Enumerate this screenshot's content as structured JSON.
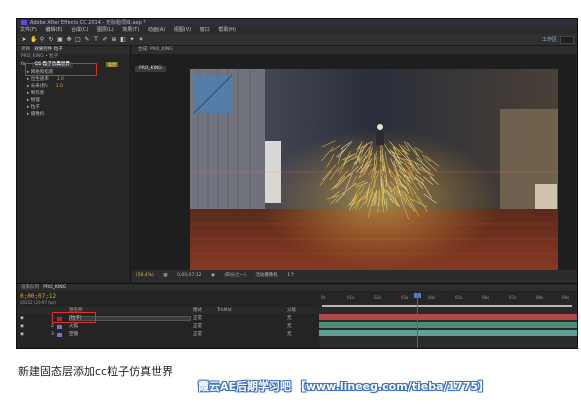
{
  "app": {
    "title": "Adobe After Effects CC 2014 - 无标题项目.aep *",
    "menu": [
      "文件(F)",
      "编辑(E)",
      "合成(C)",
      "图层(L)",
      "效果(T)",
      "动画(A)",
      "视图(V)",
      "窗口",
      "帮助(H)"
    ],
    "workspace": "工作区"
  },
  "effect_controls": {
    "tab_project": "项目",
    "tab_effect": "效果控件 粒子",
    "layer_path": "PRO_KING • 粒子",
    "effect_name": "CC 粒子仿真世界",
    "reset_label": "重置",
    "properties": [
      {
        "label": "网格和指南",
        "value": ""
      },
      {
        "label": "出生速率",
        "value": "1.0"
      },
      {
        "label": "长寿(秒)",
        "value": "1.0"
      },
      {
        "label": "制作者",
        "value": ""
      },
      {
        "label": "物理",
        "value": ""
      },
      {
        "label": "粒子",
        "value": ""
      },
      {
        "label": "摄像机",
        "value": ""
      }
    ]
  },
  "viewer": {
    "tab_label": "合成: PRO_KING",
    "comp_tab": "PRO_KING",
    "zoom": "(56.4%)",
    "timecode": "0;00;07;12",
    "resolution": "(四分之一)",
    "camera": "活动摄像机",
    "views": "1个"
  },
  "timeline": {
    "tab_render": "渲染队列",
    "tab_comp": "PRO_KING",
    "timecode": "0;00;07;12",
    "fps": "00222 (29.97 fps)",
    "col_source": "源名称",
    "col_mode": "模式",
    "col_trkmat": "TrkMat",
    "col_parent": "父级",
    "ruler": [
      "0s",
      "01s",
      "02s",
      "03s",
      "04s",
      "05s",
      "06s",
      "07s",
      "08s",
      "09s"
    ],
    "layers": [
      {
        "num": "1",
        "name": "[粒子]",
        "mode": "正常",
        "parent": "无",
        "color": "#b02a2a"
      },
      {
        "num": "2",
        "name": "火焰",
        "mode": "正常",
        "parent": "无",
        "color": "#8866cc"
      },
      {
        "num": "3",
        "name": "空镜",
        "mode": "正常",
        "parent": "无",
        "color": "#8866cc"
      }
    ]
  },
  "caption": "新建固态层添加cc粒子仿真世界",
  "watermark": "霞云AE后期学习吧 【www.lineeg.com/tieba/1775】",
  "colors": {
    "highlight_red": "#e0302a",
    "timecode_orange": "#e8a830",
    "layer1_bar": "#b14848",
    "layer2_bar": "#4e8c7a",
    "layer3_bar": "#5fa295"
  }
}
